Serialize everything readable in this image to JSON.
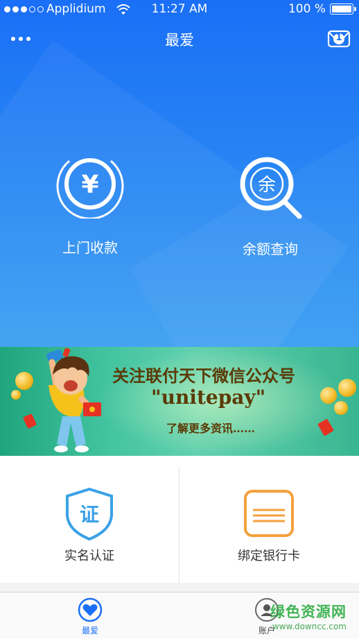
{
  "status_bar": {
    "carrier": "Applidium",
    "time": "11:27 AM",
    "battery": "100 %"
  },
  "nav": {
    "title": "最爱",
    "badge_count": "1"
  },
  "features": [
    {
      "label": "上门收款",
      "icon": "yen-coin-icon",
      "glyph": "¥"
    },
    {
      "label": "余额查询",
      "icon": "balance-search-icon",
      "glyph": "余"
    }
  ],
  "banner": {
    "line1": "关注联付天下微信公众号",
    "line2": "\"unitepay\"",
    "line3": "了解更多资讯……"
  },
  "cards": [
    {
      "label": "实名认证",
      "icon": "verify-shield-icon",
      "glyph": "证",
      "color": "#3aa1e8"
    },
    {
      "label": "绑定银行卡",
      "icon": "bank-card-icon",
      "color": "#f5a03c"
    }
  ],
  "tabs": [
    {
      "label": "最爱",
      "icon": "heart-icon",
      "active": true,
      "color": "#1a6ff6"
    },
    {
      "label": "账户",
      "icon": "account-icon",
      "active": false
    }
  ],
  "watermark": {
    "title": "绿色资源网",
    "url": "www.downcc.com"
  },
  "colors": {
    "primary": "#1a6ff6",
    "banner_text": "#5b3a06"
  }
}
